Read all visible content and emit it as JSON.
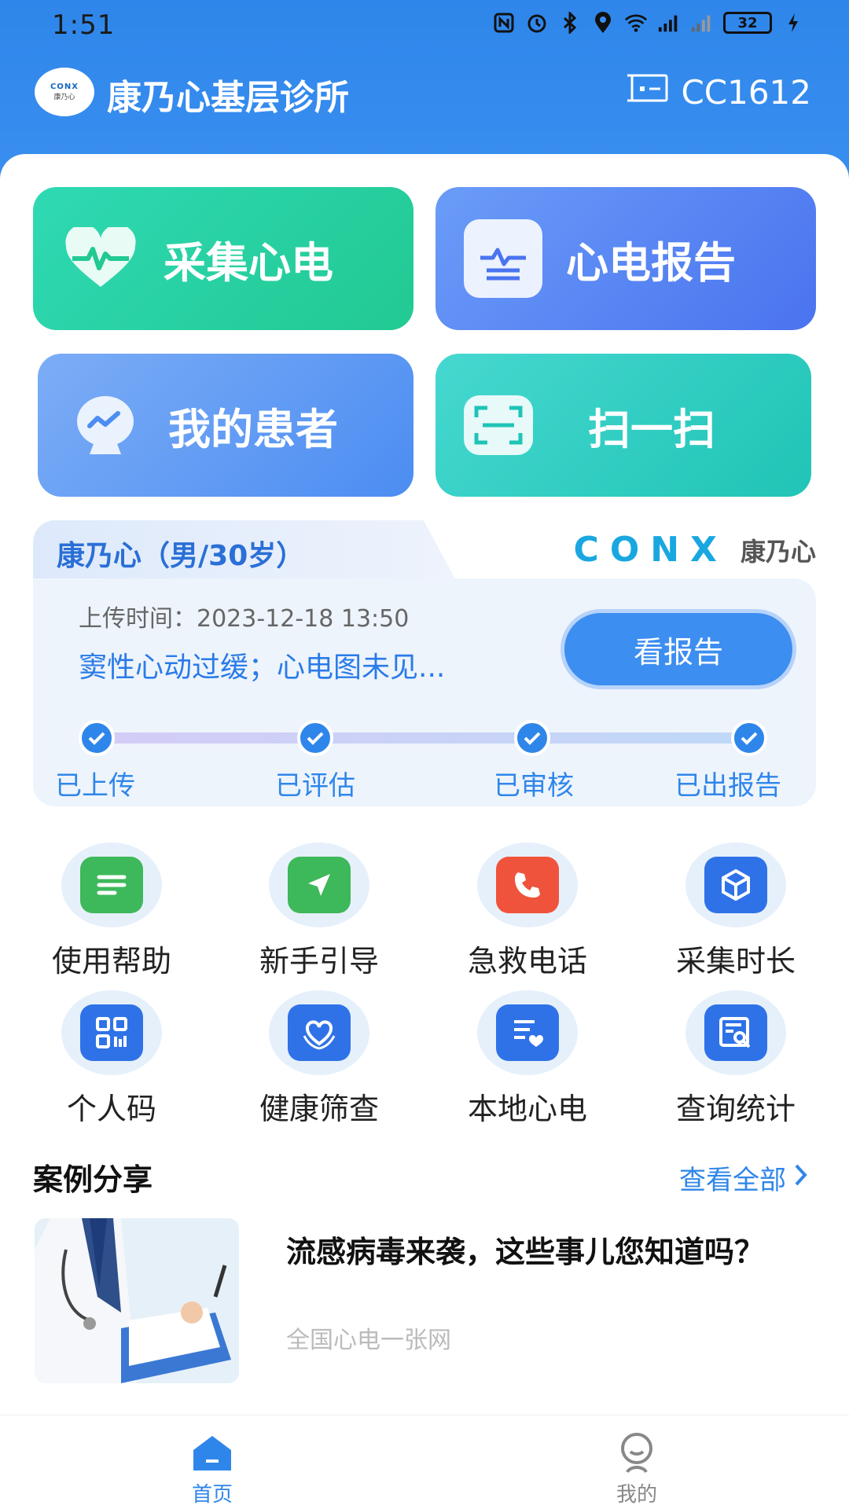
{
  "status_bar": {
    "time": "1:51",
    "battery": "32"
  },
  "header": {
    "clinic_name": "康乃心基层诊所",
    "device_id": "CC1612",
    "logo_en": "CONX",
    "logo_cn": "康乃心"
  },
  "actions": {
    "collect": "采集心电",
    "report": "心电报告",
    "patients": "我的患者",
    "scan": "扫一扫"
  },
  "report_card": {
    "patient": "康乃心（男/30岁）",
    "brand_en": "CONX",
    "brand_cn": "康乃心",
    "upload_time": "上传时间：2023-12-18 13:50",
    "diagnosis": "窦性心动过缓；心电图未见...",
    "view_button": "看报告",
    "steps": [
      "已上传",
      "已评估",
      "已审核",
      "已出报告"
    ]
  },
  "grid": [
    {
      "label": "使用帮助",
      "icon": "help-doc-icon",
      "color": "#3db85a"
    },
    {
      "label": "新手引导",
      "icon": "navigation-arrow-icon",
      "color": "#3db85a"
    },
    {
      "label": "急救电话",
      "icon": "phone-icon",
      "color": "#f0533c"
    },
    {
      "label": "采集时长",
      "icon": "cube-icon",
      "color": "#2f72e8"
    },
    {
      "label": "个人码",
      "icon": "qr-code-icon",
      "color": "#2f72e8"
    },
    {
      "label": "健康筛查",
      "icon": "heart-hand-icon",
      "color": "#2f72e8"
    },
    {
      "label": "本地心电",
      "icon": "local-ecg-icon",
      "color": "#2f72e8"
    },
    {
      "label": "查询统计",
      "icon": "search-report-icon",
      "color": "#2f72e8"
    }
  ],
  "cases": {
    "section_title": "案例分享",
    "see_all": "查看全部",
    "items": [
      {
        "title": "流感病毒来袭，这些事儿您知道吗？",
        "source": "全国心电一张网"
      }
    ]
  },
  "bottom_nav": [
    {
      "label": "首页",
      "active": true
    },
    {
      "label": "我的",
      "active": false
    }
  ],
  "colors": {
    "primary": "#2f86ea",
    "green": "#22c993",
    "teal": "#20c4b6"
  }
}
